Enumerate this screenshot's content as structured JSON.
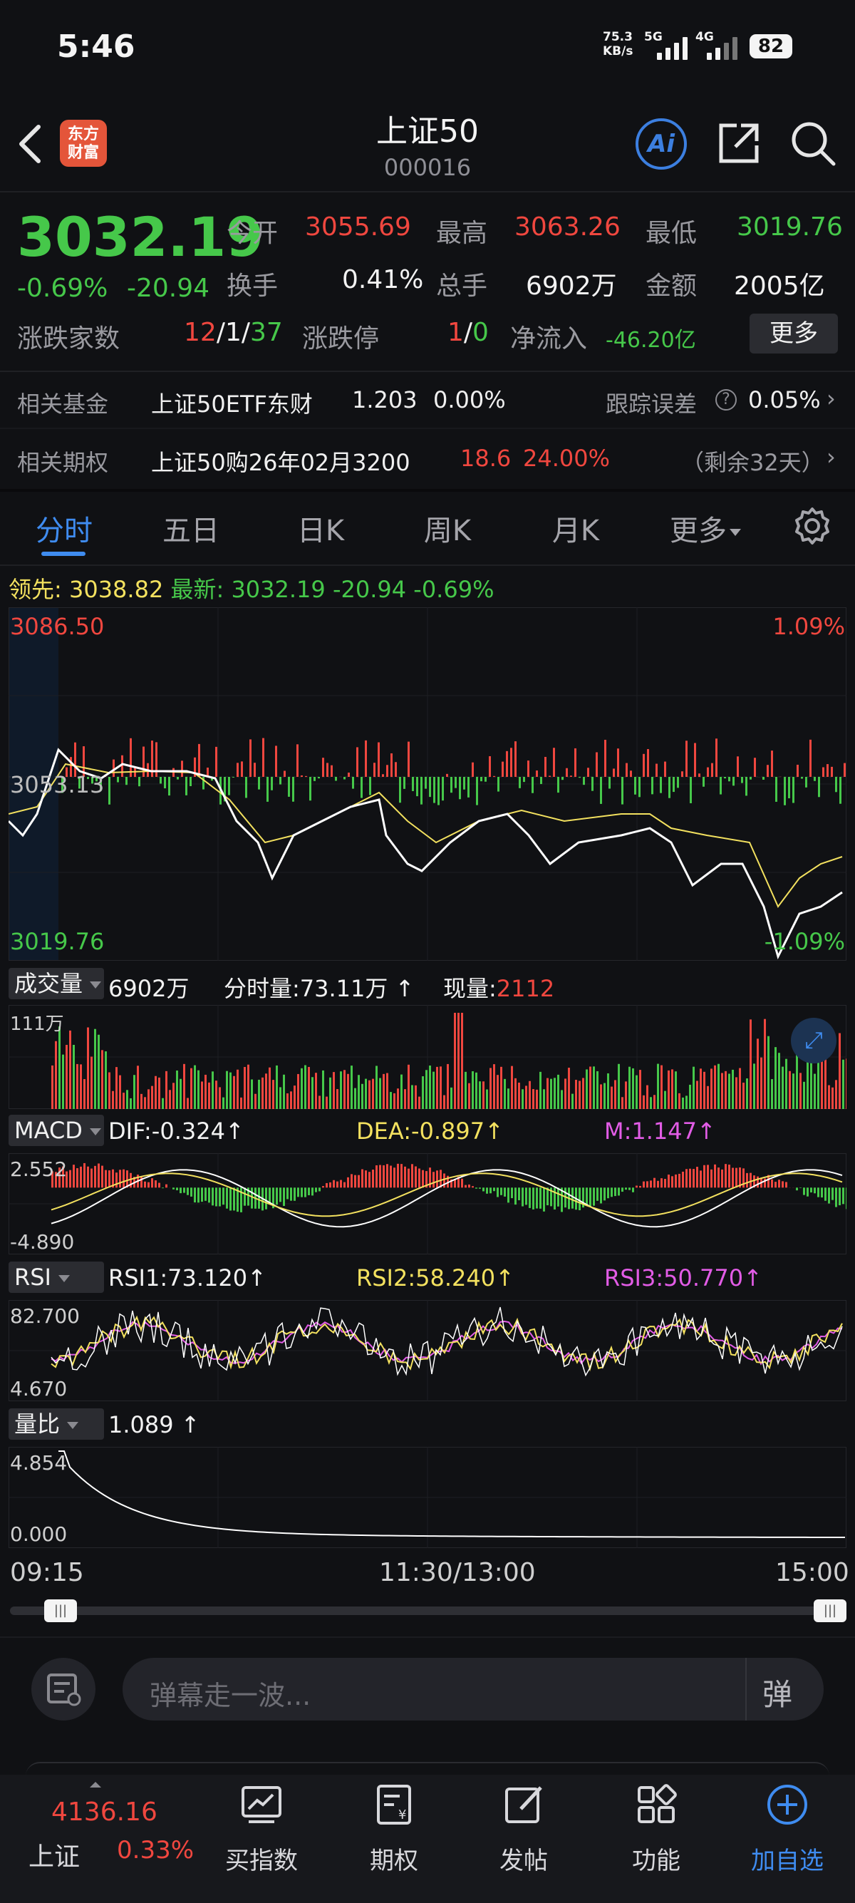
{
  "status": {
    "time": "5:46",
    "net_speed": "75.3",
    "net_unit": "KB/s",
    "net1": "5G",
    "net2": "4G",
    "battery": "82"
  },
  "header": {
    "logo_line1": "东方",
    "logo_line2": "财富",
    "title": "上证50",
    "code": "000016",
    "ai_label": "Ai"
  },
  "quote": {
    "price": "3032.19",
    "change_pct": "-0.69%",
    "change": "-20.94",
    "open_label": "今开",
    "open": "3055.69",
    "high_label": "最高",
    "high": "3063.26",
    "low_label": "最低",
    "low": "3019.76",
    "turnover_label": "换手",
    "turnover": "0.41%",
    "volume_label": "总手",
    "volume": "6902万",
    "amount_label": "金额",
    "amount": "2005亿",
    "breadth_label": "涨跌家数",
    "up": "12",
    "flat": "1",
    "down": "37",
    "sep": "/",
    "limit_label": "涨跌停",
    "limit_up": "1",
    "limit_down": "0",
    "netflow_label": "净流入",
    "netflow": "-46.20亿",
    "more_btn": "更多"
  },
  "related": {
    "fund_label": "相关基金",
    "fund_name": "上证50ETF东财",
    "fund_price": "1.203",
    "fund_pct": "0.00%",
    "track_label": "跟踪误差",
    "track_value": "0.05%",
    "option_label": "相关期权",
    "option_name": "上证50购26年02月3200",
    "option_price": "18.6",
    "option_pct": "24.00%",
    "option_remain": "（剩余32天）"
  },
  "tabs": [
    "分时",
    "五日",
    "日K",
    "周K",
    "月K",
    "更多"
  ],
  "intraday": {
    "lead_label": "领先:",
    "lead_value": "3038.82",
    "latest_label": "最新:",
    "latest_value": "3032.19",
    "change": "-20.94",
    "pct": "-0.69%",
    "top_price": "3086.50",
    "mid_price": "3053.13",
    "bottom_price": "3019.76",
    "top_pct": "1.09%",
    "bottom_pct": "-1.09%"
  },
  "volume_panel": {
    "label": "成交量",
    "total": "6902万",
    "minute_label": "分时量:73.11万",
    "now_label": "现量:",
    "now_value": "2112",
    "axis_max": "111万"
  },
  "macd": {
    "label": "MACD",
    "dif": "DIF:-0.324",
    "dea": "DEA:-0.897",
    "m": "M:1.147",
    "axis_max": "2.552",
    "axis_min": "-4.890"
  },
  "rsi": {
    "label": "RSI",
    "rsi1": "RSI1:73.120",
    "rsi2": "RSI2:58.240",
    "rsi3": "RSI3:50.770",
    "axis_max": "82.700",
    "axis_min": "4.670"
  },
  "vol_ratio": {
    "label": "量比",
    "value": "1.089",
    "axis_max": "4.854",
    "axis_min": "0.000"
  },
  "time_axis": {
    "start": "09:15",
    "mid": "11:30/13:00",
    "end": "15:00"
  },
  "danmu": {
    "placeholder": "弹幕走一波...",
    "send_icon_label": "弹"
  },
  "bottom_nav": {
    "index_price": "4136.16",
    "index_name": "上证",
    "index_pct": "0.33%",
    "items": [
      "买指数",
      "期权",
      "发帖",
      "功能",
      "加自选"
    ]
  },
  "colors": {
    "up": "#f0473f",
    "down": "#46c84a",
    "accent": "#3f8cf0",
    "avg_line": "#f3e15f",
    "price_line": "#ffffff"
  }
}
